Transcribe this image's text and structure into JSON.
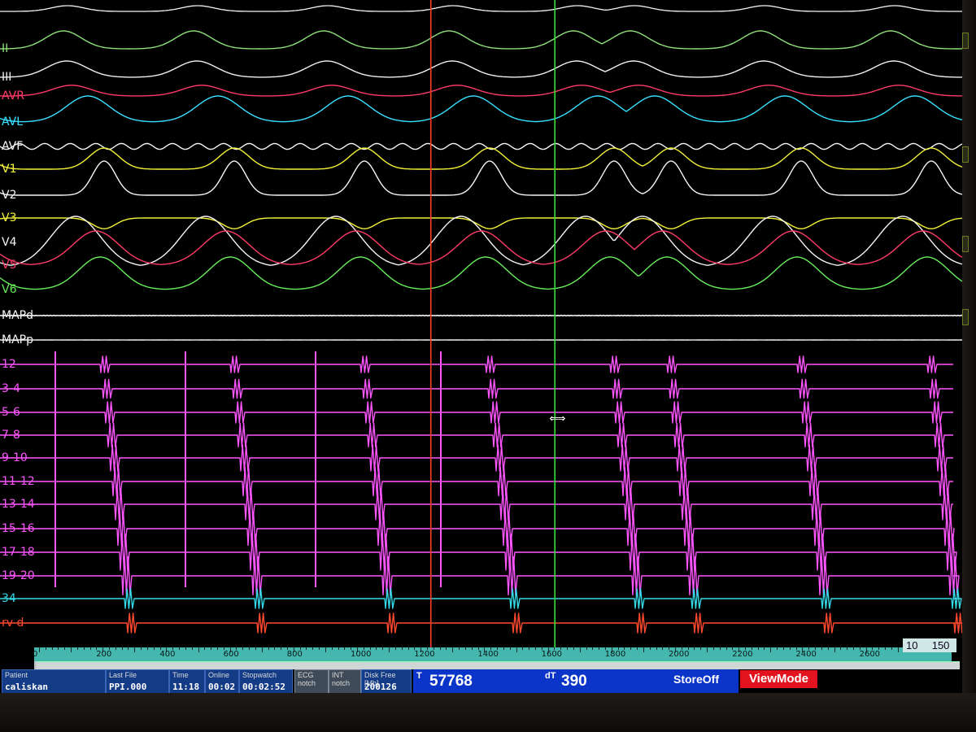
{
  "channels": {
    "surface": [
      {
        "label": "II",
        "color": "#8ee07a"
      },
      {
        "label": "III",
        "color": "#f0f0f0"
      },
      {
        "label": "AVR",
        "color": "#ff3b66"
      },
      {
        "label": "AVL",
        "color": "#37e1ff"
      },
      {
        "label": "AVF",
        "color": "#f5f5f5"
      },
      {
        "label": "V1",
        "color": "#f3f23a"
      },
      {
        "label": "V2",
        "color": "#f5f5f5"
      },
      {
        "label": "V3",
        "color": "#f3f23a"
      },
      {
        "label": "V4",
        "color": "#f5f5f5"
      },
      {
        "label": "V5",
        "color": "#ff3b66"
      },
      {
        "label": "V6",
        "color": "#67f05a"
      },
      {
        "label": "MAPd",
        "color": "#f5f5f5"
      },
      {
        "label": "MAPp",
        "color": "#f5f5f5"
      }
    ],
    "intracardiac": [
      {
        "label": "12",
        "color": "#ff55ff"
      },
      {
        "label": "3-4",
        "color": "#ff55ff"
      },
      {
        "label": "5-6",
        "color": "#ff55ff"
      },
      {
        "label": "7-8",
        "color": "#ff55ff"
      },
      {
        "label": "9-10",
        "color": "#ff55ff"
      },
      {
        "label": "11-12",
        "color": "#ff55ff"
      },
      {
        "label": "13-14",
        "color": "#ff55ff"
      },
      {
        "label": "15-16",
        "color": "#ff55ff"
      },
      {
        "label": "17-18",
        "color": "#ff55ff"
      },
      {
        "label": "19-20",
        "color": "#ff55ff"
      },
      {
        "label": "34",
        "color": "#36d9e6"
      },
      {
        "label": "rv d",
        "color": "#ff4a30"
      }
    ]
  },
  "timeline": {
    "ticks": [
      "0",
      "200",
      "400",
      "600",
      "800",
      "1000",
      "1200",
      "1400",
      "1600",
      "1800",
      "2000",
      "2200",
      "2400",
      "2600"
    ],
    "scale_a": "10",
    "scale_b": "150"
  },
  "calipers": {
    "red_ms": 1232,
    "green_ms": 1622,
    "red_color": "#ff3d2e",
    "green_color": "#38e03a"
  },
  "status": {
    "patient_label": "Patient",
    "patient_value": "caliskan",
    "last_file_label": "Last File",
    "last_file_value": "PPI.000",
    "time_label": "Time",
    "time_value": "11:18",
    "online_label": "Online",
    "online_value": "00:02",
    "stopwatch_label": "Stopwatch",
    "stopwatch_value": "00:02:52",
    "ecg_notch_label": "ECG notch",
    "int_notch_label": "INT notch",
    "disk_free_label": "Disk Free [Mb]",
    "disk_free_value": "200126",
    "t_label": "T",
    "t_value": "57768",
    "dt_label": "dT",
    "dt_value": "390",
    "store_label": "StoreOff",
    "mode_label": "ViewMode"
  }
}
